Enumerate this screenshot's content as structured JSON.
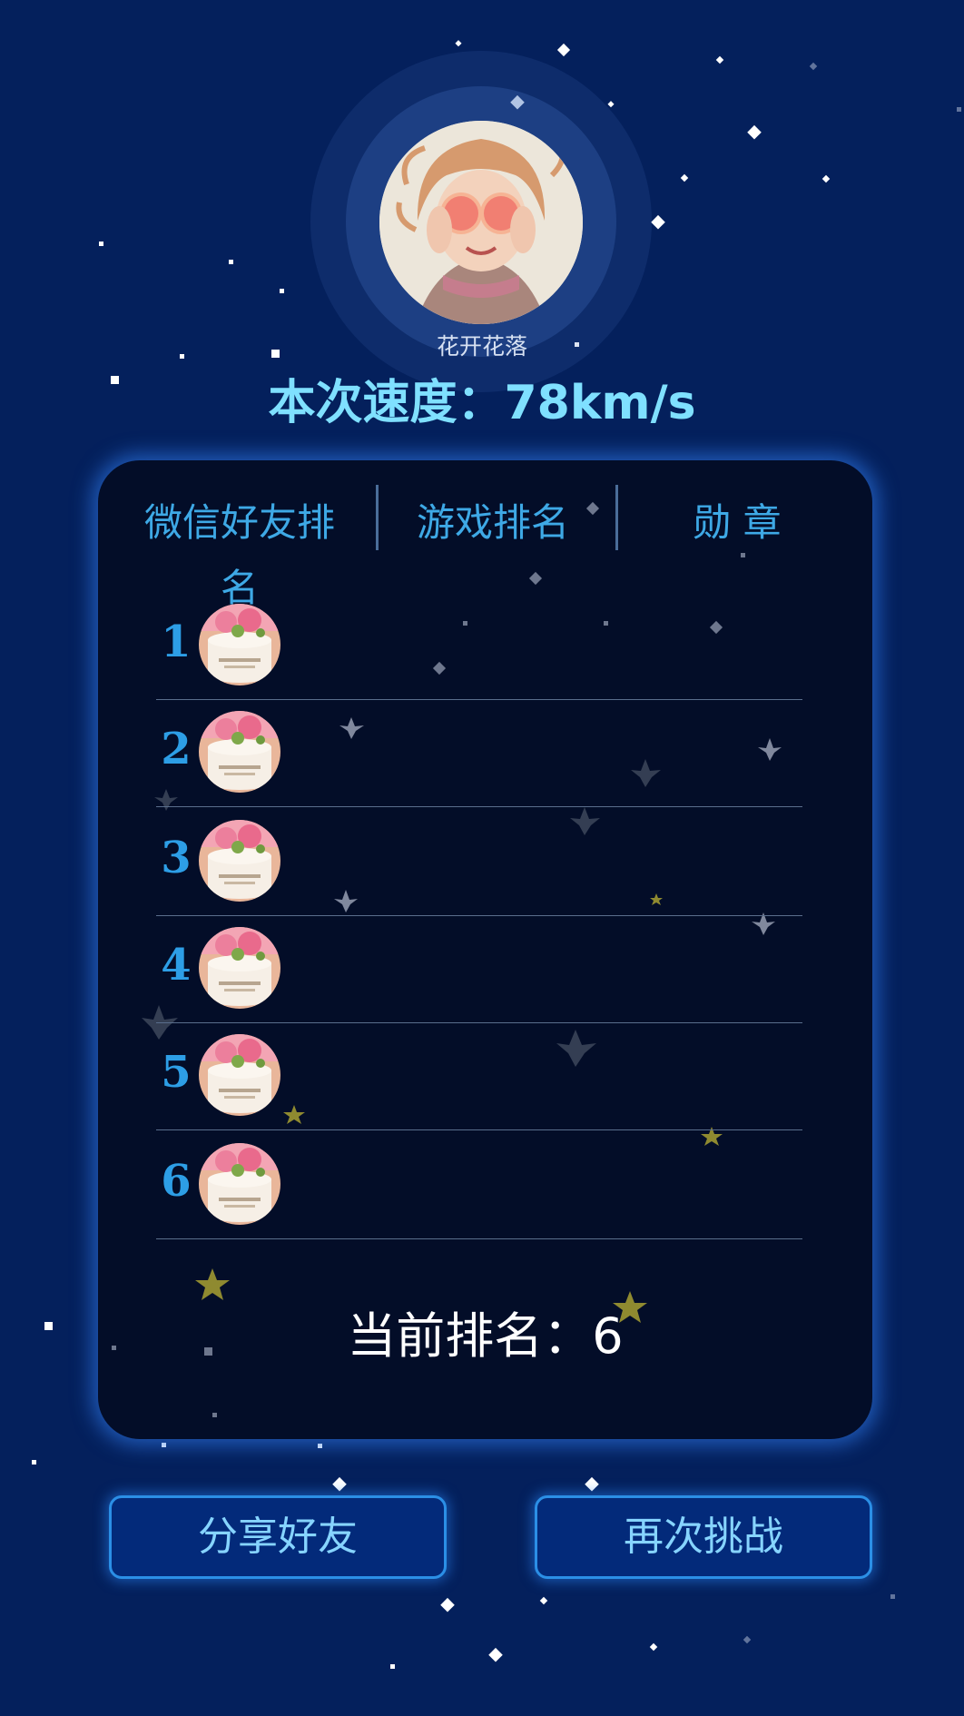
{
  "profile": {
    "username": "花开花落",
    "speed_label": "本次速度：78km/s"
  },
  "tabs": [
    {
      "label": "微信好友排名"
    },
    {
      "label": "游戏排名"
    },
    {
      "label": "勋 章"
    }
  ],
  "ranking": [
    {
      "rank": "1"
    },
    {
      "rank": "2"
    },
    {
      "rank": "3"
    },
    {
      "rank": "4"
    },
    {
      "rank": "5"
    },
    {
      "rank": "6"
    }
  ],
  "current_rank_label": "当前排名：6",
  "buttons": {
    "share": "分享好友",
    "retry": "再次挑战"
  },
  "colors": {
    "background": "#04205c",
    "panel": "#030d28",
    "accent_cyan": "#7fe0ff",
    "tab_text": "#3ea9e6",
    "rank_number": "#2d9ee6",
    "button_fill": "#032a7a",
    "button_border": "#2b8fe6"
  }
}
